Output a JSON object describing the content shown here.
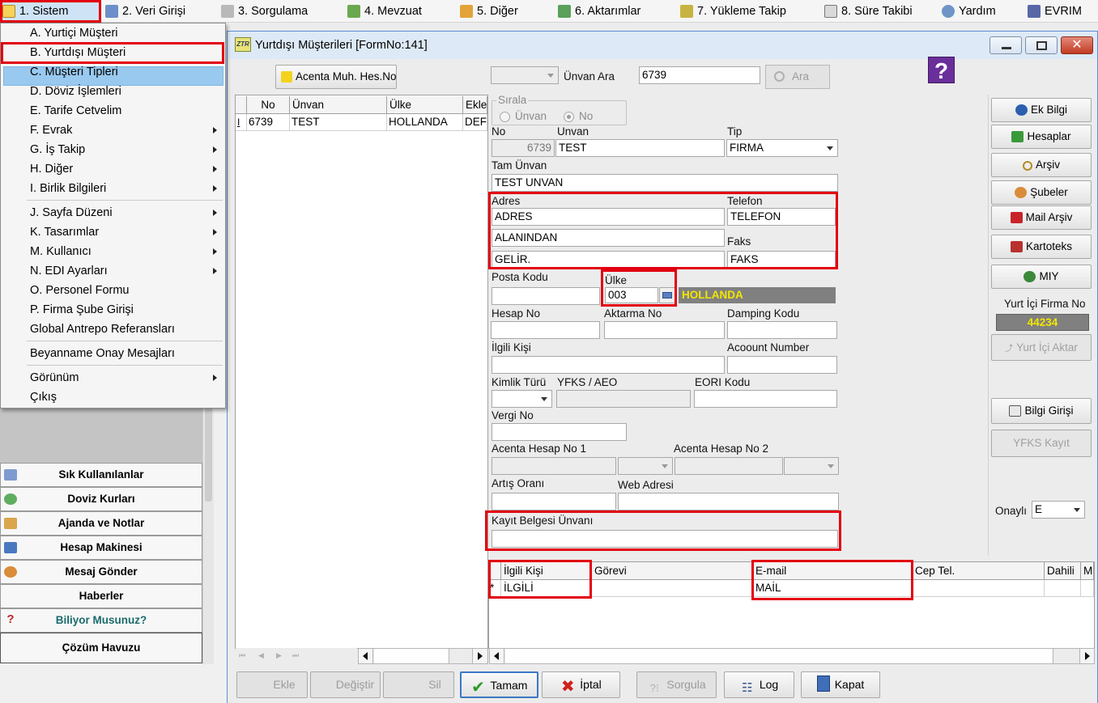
{
  "menubar": {
    "items": [
      {
        "label": "1.  Sistem"
      },
      {
        "label": "2.   Veri Girişi"
      },
      {
        "label": "3.   Sorgulama"
      },
      {
        "label": "4.   Mevzuat"
      },
      {
        "label": "5.   Diğer"
      },
      {
        "label": "6.   Aktarımlar"
      },
      {
        "label": "7.   Yükleme Takip"
      },
      {
        "label": "8. Süre Takibi"
      },
      {
        "label": "Yardım"
      },
      {
        "label": "EVRIM"
      }
    ]
  },
  "dropdown": {
    "items": [
      {
        "label": "A.  Yurtiçi Müşteri"
      },
      {
        "label": "B.  Yurtdışı Müşteri"
      },
      {
        "label": "C.  Müşteri Tipleri"
      },
      {
        "label": "D.   Döviz İşlemleri"
      },
      {
        "label": "E.   Tarife Cetvelim"
      },
      {
        "label": "F.   Evrak"
      },
      {
        "label": "G.   İş Takip"
      },
      {
        "label": "H.   Diğer"
      },
      {
        "label": "I.   Birlik Bilgileri"
      },
      {
        "label": "J.   Sayfa Düzeni"
      },
      {
        "label": "K.   Tasarımlar"
      },
      {
        "label": "M.   Kullanıcı"
      },
      {
        "label": "N.   EDI Ayarları"
      },
      {
        "label": "O.   Personel Formu"
      },
      {
        "label": "P.   Firma Şube Girişi"
      },
      {
        "label": "Global Antrepo Referansları"
      },
      {
        "label": "Beyanname Onay Mesajları"
      },
      {
        "label": "Görünüm"
      },
      {
        "label": "Çıkış"
      }
    ]
  },
  "leftpanel": {
    "buttons": [
      {
        "label": "Sık Kullanılanlar"
      },
      {
        "label": "Doviz Kurları"
      },
      {
        "label": "Ajanda ve Notlar"
      },
      {
        "label": "Hesap Makinesi"
      },
      {
        "label": "Mesaj Gönder"
      },
      {
        "label": "Haberler"
      },
      {
        "label": "Biliyor Musunuz?"
      },
      {
        "label": "Çözüm Havuzu"
      }
    ]
  },
  "window": {
    "title": "Yurtdışı Müşterileri [FormNo:141]",
    "icon_text": "ZTR"
  },
  "toolbar": {
    "acenta_label": "Acenta Muh. Hes.No",
    "unvan_ara_label": "Ünvan Ara",
    "search_value": "6739",
    "ara_label": "Ara"
  },
  "grid": {
    "columns": [
      "",
      "No",
      "Ünvan",
      "Ülke",
      "Ekle"
    ],
    "rows": [
      [
        "I",
        "6739",
        "TEST",
        "HOLLANDA",
        "DEF"
      ]
    ]
  },
  "form": {
    "sirala_label": "Sırala",
    "sirala_unvan": "Ünvan",
    "sirala_no": "No",
    "no_label": "No",
    "no_value": "6739",
    "unvan_label": "Unvan",
    "unvan_value": "TEST",
    "tip_label": "Tip",
    "tip_value": "FIRMA",
    "tam_unvan_label": "Tam Ünvan",
    "tam_unvan_value": "TEST UNVAN",
    "adres_label": "Adres",
    "adres_line1": "ADRES",
    "adres_line2": "ALANINDAN",
    "adres_line3": "GELİR.",
    "telefon_label": "Telefon",
    "telefon_value": "TELEFON",
    "faks_label": "Faks",
    "faks_value": "FAKS",
    "posta_kodu_label": "Posta Kodu",
    "ulke_label": "Ülke",
    "ulke_code": "003",
    "ulke_name": "HOLLANDA",
    "hesap_no_label": "Hesap No",
    "aktarma_no_label": "Aktarma No",
    "damping_kodu_label": "Damping Kodu",
    "ilgili_kisi_label": "İlgili Kişi",
    "account_number_label": "Acoount Number",
    "kimlik_turu_label": "Kimlik Türü",
    "yfks_label": "YFKS / AEO",
    "eori_label": "EORI Kodu",
    "vergi_no_label": "Vergi No",
    "acenta_hesap1_label": "Acenta Hesap No 1",
    "acenta_hesap2_label": "Acenta Hesap No 2",
    "artis_orani_label": "Artış Oranı",
    "web_adresi_label": "Web Adresi",
    "kayit_belgesi_label": "Kayıt Belgesi Ünvanı"
  },
  "rightpanel": {
    "buttons": [
      {
        "label": "Ek Bilgi"
      },
      {
        "label": "Hesaplar"
      },
      {
        "label": "Arşiv"
      },
      {
        "label": "Şubeler"
      },
      {
        "label": "Mail Arşiv"
      },
      {
        "label": "Kartoteks"
      },
      {
        "label": "MIY"
      }
    ],
    "yurt_ici_firma_no_label": "Yurt İçi Firma No",
    "yurt_ici_firma_no_value": "44234",
    "yurt_ici_aktar_label": "Yurt İçi Aktar",
    "bilgi_girisi_label": "Bilgi Girişi",
    "yfks_kayit_label": "YFKS Kayıt",
    "onayli_label": "Onaylı",
    "onayli_value": "E"
  },
  "contacts": {
    "columns": [
      "",
      "İlgili Kişi",
      "Görevi",
      "E-mail",
      "Cep Tel.",
      "Dahili",
      "M"
    ],
    "rows": [
      [
        "*",
        "İLGİLİ",
        "",
        "MAİL",
        "",
        "",
        ""
      ]
    ]
  },
  "bottombar": {
    "ekle": "Ekle",
    "degistir": "Değiştir",
    "sil": "Sil",
    "tamam": "Tamam",
    "iptal": "İptal",
    "sorgula": "Sorgula",
    "log": "Log",
    "kapat": "Kapat"
  },
  "colors": {
    "highlight_red": "#e3000f",
    "menu_highlight": "#99c9ef",
    "country_bar": "#808080",
    "country_text": "#f2e600"
  }
}
